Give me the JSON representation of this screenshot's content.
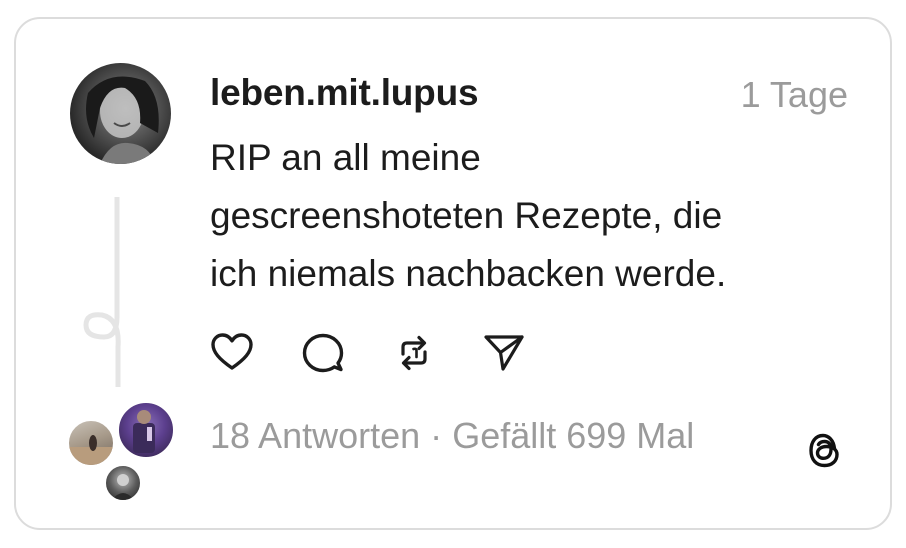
{
  "post": {
    "username": "leben.mit.lupus",
    "timestamp": "1 Tage",
    "text_lines": [
      "RIP an all meine",
      "gescreenshoteten Rezepte, die",
      "ich niemals nachbacken werde."
    ],
    "replies_label": "18 Antworten",
    "separator": "·",
    "likes_label": "Gefällt 699 Mal"
  },
  "icons": {
    "like": "heart-icon",
    "comment": "comment-bubble-icon",
    "repost": "repost-icon",
    "share": "send-paper-plane-icon",
    "brand": "threads-logo-icon"
  },
  "colors": {
    "text": "#1c1c1c",
    "muted": "#9b9b9b",
    "border": "#dcdcdc",
    "thread_line": "#e5e5e5"
  }
}
